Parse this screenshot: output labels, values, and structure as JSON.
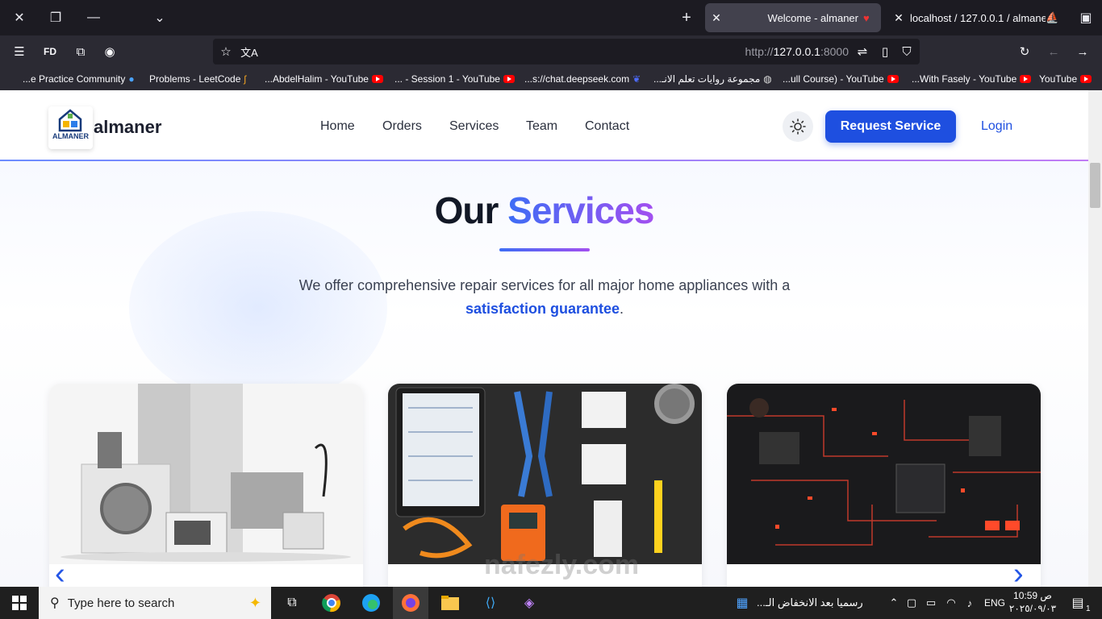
{
  "browser": {
    "window_controls": {
      "close": "✕",
      "restore": "❐",
      "minimize": "—",
      "dropdown": "⌄"
    },
    "new_tab": "+",
    "tabs": [
      {
        "title": "Welcome - almaner",
        "active": true
      },
      {
        "title": "localhost / 127.0.0.1 / almaner",
        "active": false
      }
    ],
    "url_prefix": "http://",
    "url_host": "127.0.0.1",
    "url_port": ":8000",
    "bookmarks": [
      "...e Practice Community",
      "Problems - LeetCode",
      "...AbdelHalim - YouTube",
      "... - Session 1 - YouTube",
      "...s://chat.deepseek.com",
      "مجموعة روايات تعلم الانـ...",
      "...ull Course) - YouTube",
      "...With Fasely - YouTube",
      "YouTube"
    ]
  },
  "site": {
    "logo_text": "ALMANER",
    "brand": "almaner",
    "nav": [
      "Home",
      "Orders",
      "Services",
      "Team",
      "Contact"
    ],
    "request_button": "Request Service",
    "login": "Login",
    "heading_plain": "Our",
    "heading_accent": "Services",
    "subtitle_main": "We offer comprehensive repair services for all major home appliances with a",
    "subtitle_highlight": "satisfaction guarantee",
    "subtitle_end": ".",
    "cards": [
      {
        "image": "home-appliances"
      },
      {
        "image": "electrical-tools"
      },
      {
        "image": "circuit-board"
      }
    ],
    "prev_arrow": "‹",
    "next_arrow": "›"
  },
  "watermark": "nafezly.com",
  "taskbar": {
    "search_placeholder": "Type here to search",
    "news_text": "رسميا بعد الانخفاض الـ...",
    "language": "ENG",
    "time": "10:59",
    "ampm": "ص",
    "date": "٢٠٢٥/٠٩/٠٣",
    "notification_count": "1"
  }
}
